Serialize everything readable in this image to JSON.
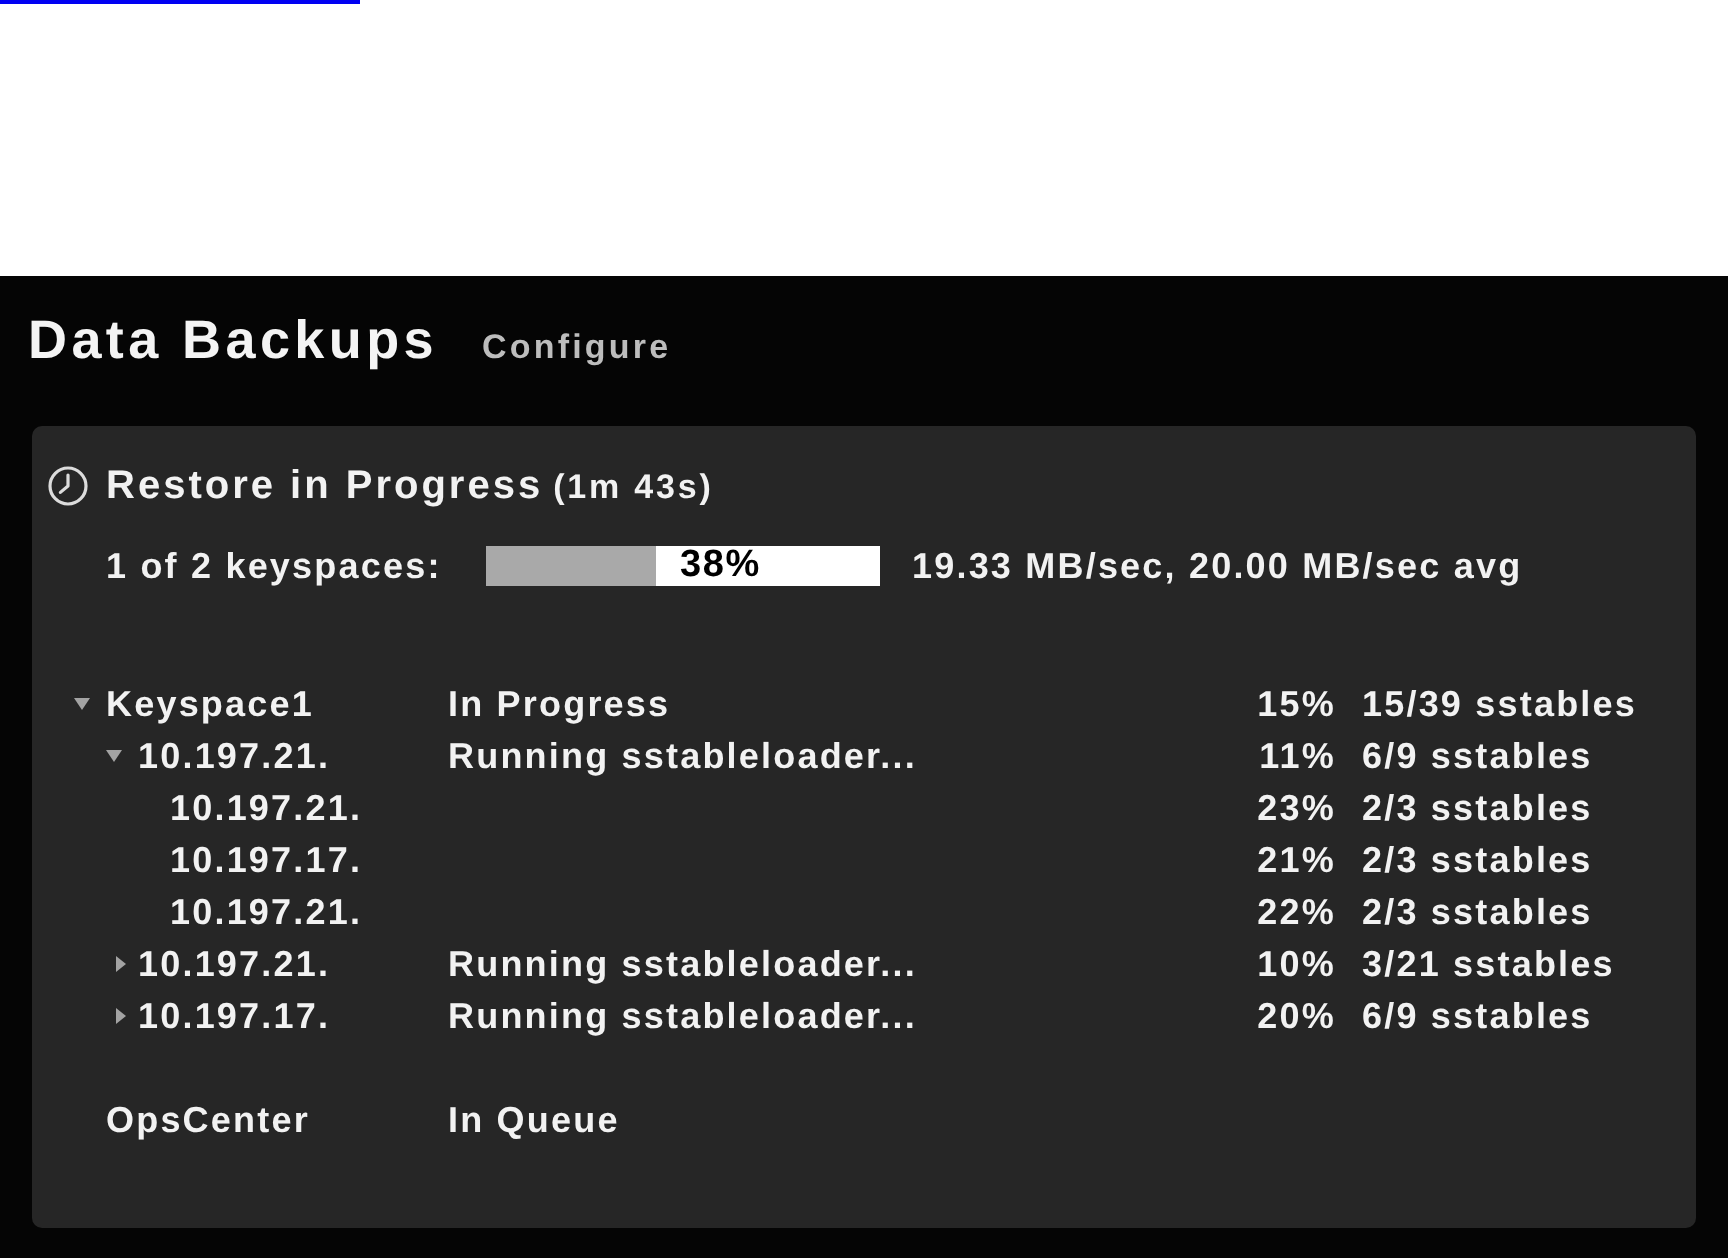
{
  "header": {
    "title": "Data Backups",
    "configure_link": "Configure"
  },
  "restore": {
    "title": "Restore in Progress",
    "elapsed": "(1m 43s)",
    "progress_label": "1 of 2 keyspaces:",
    "progress": {
      "level": 0.43,
      "label": "38%"
    },
    "rate": "19.33 MB/sec, 20.00 MB/sec avg"
  },
  "tree": [
    {
      "label": "Keyspace1",
      "status": "In Progress",
      "percent": "15%",
      "sstables": "15/39 sstables",
      "expanded": true,
      "children": [
        {
          "label": "10.197.21.",
          "status": "Running sstableloader...",
          "percent": "11%",
          "sstables": "6/9 sstables",
          "expanded": true,
          "children": [
            {
              "label": "10.197.21.",
              "percent": "23%",
              "sstables": "2/3 sstables"
            },
            {
              "label": "10.197.17.",
              "percent": "21%",
              "sstables": "2/3 sstables"
            },
            {
              "label": "10.197.21.",
              "percent": "22%",
              "sstables": "2/3 sstables"
            }
          ]
        },
        {
          "label": "10.197.21.",
          "status": "Running sstableloader...",
          "percent": "10%",
          "sstables": "3/21 sstables",
          "expanded": false
        },
        {
          "label": "10.197.17.",
          "status": "Running sstableloader...",
          "percent": "20%",
          "sstables": "6/9 sstables",
          "expanded": false
        }
      ]
    },
    {
      "label": "OpsCenter",
      "status": "In Queue"
    }
  ]
}
